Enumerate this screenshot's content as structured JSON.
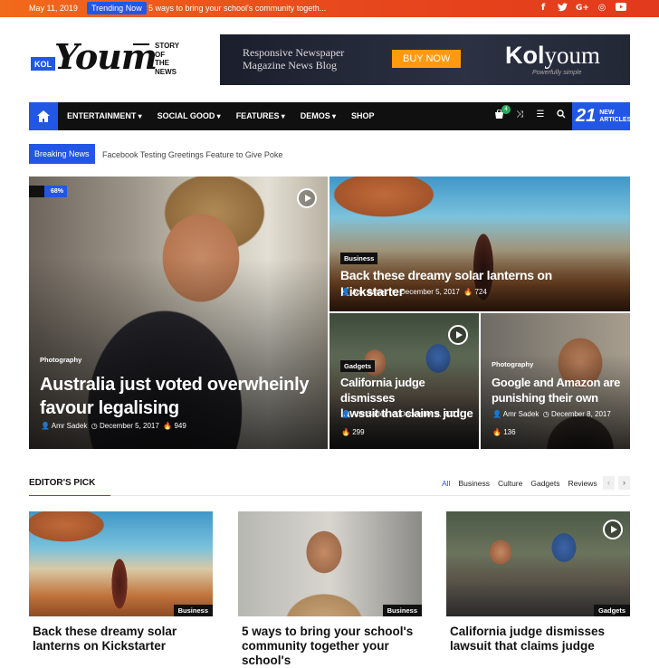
{
  "topbar": {
    "date": "May 11, 2019",
    "trending_label": "Trending Now",
    "ticker": "5 ways to bring your school's community togeth...",
    "social": [
      {
        "icon": "facebook-icon",
        "glyph": "f"
      },
      {
        "icon": "twitter-icon",
        "glyph": "🐦"
      },
      {
        "icon": "google-plus-icon",
        "glyph": "G+"
      },
      {
        "icon": "dribbble-icon",
        "glyph": "◎"
      },
      {
        "icon": "youtube-icon",
        "glyph": "▶"
      }
    ]
  },
  "header": {
    "logo_badge": "KOL",
    "logo_name": "Youm",
    "logo_tagline": [
      "STORY",
      "OF",
      "THE",
      "NEWS"
    ],
    "ad": {
      "line1": "Responsive Newspaper",
      "line2": "Magazine News Blog",
      "button": "BUY NOW",
      "brand_bold": "Kol",
      "brand_rest": "youm",
      "brand_sub": "Powerfully simple"
    }
  },
  "nav": {
    "items": [
      {
        "label": "ENTERTAINMENT",
        "dropdown": true
      },
      {
        "label": "SOCIAL GOOD",
        "dropdown": true
      },
      {
        "label": "FEATURES",
        "dropdown": true
      },
      {
        "label": "DEMOS",
        "dropdown": true
      },
      {
        "label": "SHOP",
        "dropdown": false
      }
    ],
    "cart_count": "4",
    "new_articles_count": "21",
    "new_articles_line1": "NEW",
    "new_articles_line2": "ARTICLES"
  },
  "breaking": {
    "label": "Breaking News",
    "text": "Facebook Testing Greetings Feature to Give Poke"
  },
  "hero": {
    "main": {
      "percent": "68%",
      "category": "Photography",
      "title_line1": "Australia just voted overwheinly",
      "title_line2": "favour legalising",
      "author": "Amr Sadek",
      "date": "December 5, 2017",
      "views": "949"
    },
    "top_right": {
      "category": "Business",
      "title": "Back these dreamy solar lanterns on Kickstarter",
      "author": "Amr Sadek",
      "date": "December 5, 2017",
      "views": "724"
    },
    "bottom_left": {
      "category": "Gadgets",
      "title_line1": "California judge dismisses",
      "title_line2": "lawsuit that claims judge",
      "author": "Amr Sadek",
      "date": "December 6, 2017",
      "views": "299"
    },
    "bottom_right": {
      "category": "Photography",
      "title_line1": "Google and Amazon are",
      "title_line2": "punishing their own",
      "author": "Amr Sadek",
      "date": "December 8, 2017",
      "views": "136"
    }
  },
  "editors_pick": {
    "heading": "EDITOR'S PICK",
    "tabs": [
      "All",
      "Business",
      "Culture",
      "Gadgets",
      "Reviews"
    ],
    "cards": [
      {
        "category": "Business",
        "title": "Back these dreamy solar lanterns on Kickstarter"
      },
      {
        "category": "Business",
        "title": "5 ways to bring your school's community together your school's"
      },
      {
        "category": "Gadgets",
        "title": "California judge dismisses lawsuit that claims judge"
      }
    ]
  },
  "colors": {
    "accent": "#2257e6",
    "topbar": "#e8491d",
    "nav": "#101010"
  }
}
